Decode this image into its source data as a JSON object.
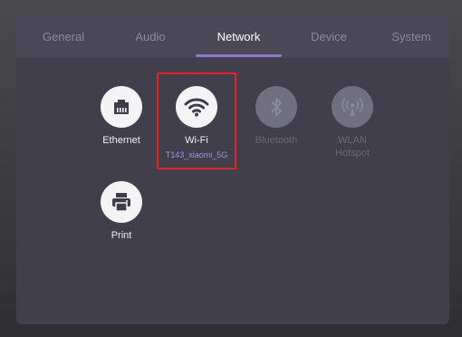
{
  "tabs": [
    {
      "label": "General",
      "active": false
    },
    {
      "label": "Audio",
      "active": false
    },
    {
      "label": "Network",
      "active": true
    },
    {
      "label": "Device",
      "active": false
    },
    {
      "label": "System",
      "active": false
    }
  ],
  "items": {
    "ethernet": {
      "label": "Ethernet",
      "icon": "ethernet-icon",
      "enabled": true
    },
    "wifi": {
      "label": "Wi-Fi",
      "sub": "T143_xiaomi_5G",
      "icon": "wifi-icon",
      "enabled": true
    },
    "bluetooth": {
      "label": "Bluetooth",
      "icon": "bluetooth-icon",
      "enabled": false
    },
    "wlan": {
      "label": "WLAN",
      "label2": "Hotspot",
      "icon": "hotspot-icon",
      "enabled": false
    },
    "print": {
      "label": "Print",
      "icon": "printer-icon",
      "enabled": true
    }
  },
  "colors": {
    "accent": "#8f77c9",
    "highlight_border": "#e0252a",
    "panel": "#413f4b",
    "disabled": "#6a6879"
  }
}
